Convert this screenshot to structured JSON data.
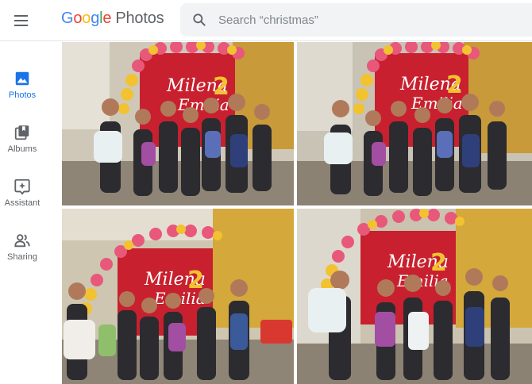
{
  "header": {
    "logo": {
      "letters": [
        "G",
        "o",
        "o",
        "g",
        "l",
        "e"
      ],
      "product": "Photos"
    },
    "search": {
      "placeholder": "Search “christmas”",
      "value": ""
    },
    "icons": {
      "menu": "menu-icon",
      "search": "search-icon"
    }
  },
  "sidebar": {
    "items": [
      {
        "label": "Photos",
        "icon": "photo-icon",
        "active": true
      },
      {
        "label": "Albums",
        "icon": "albums-icon",
        "active": false
      },
      {
        "label": "Assistant",
        "icon": "assistant-icon",
        "active": false
      },
      {
        "label": "Sharing",
        "icon": "sharing-icon",
        "active": false
      }
    ]
  },
  "photos": [
    {
      "subject": "birthday party group photo",
      "banner_text": [
        "Milena",
        "Emilia"
      ],
      "banner_number": "2"
    },
    {
      "subject": "birthday party group photo",
      "banner_text": [
        "Milena",
        "Emilia"
      ],
      "banner_number": "2"
    },
    {
      "subject": "birthday party group photo",
      "banner_text": [
        "Milena",
        "Emilia"
      ],
      "banner_number": "2"
    },
    {
      "subject": "birthday party group photo",
      "banner_text": [
        "Milena",
        "Emilia"
      ],
      "banner_number": "2"
    }
  ],
  "colors": {
    "accent": "#1a73e8",
    "nav_text": "#5f6368",
    "search_bg": "#f1f3f4",
    "banner_red": "#c8202e",
    "balloon_pink": "#e8587a",
    "balloon_yellow": "#f2c230",
    "wall_yellow": "#d4a83a"
  }
}
